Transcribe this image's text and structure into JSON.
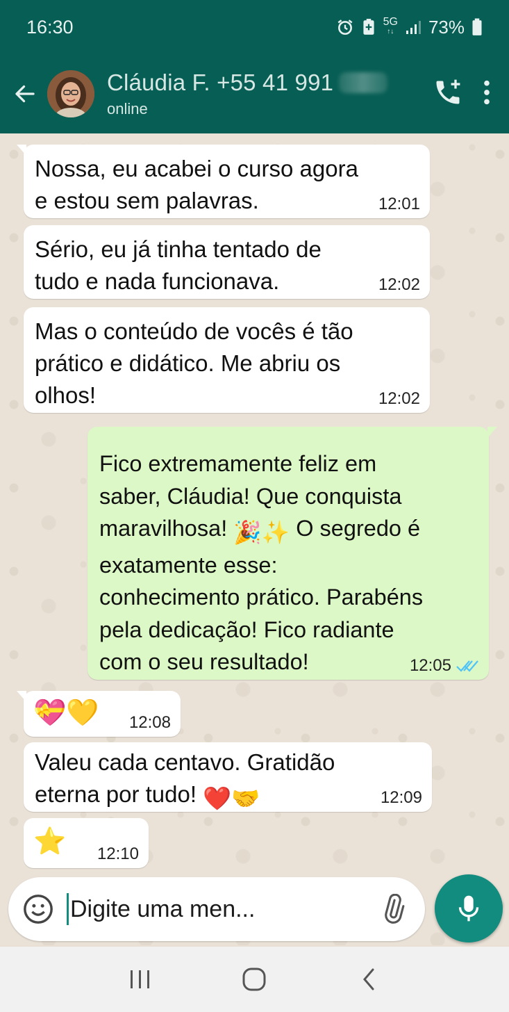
{
  "status_bar": {
    "time": "16:30",
    "network": "5G",
    "battery": "73%"
  },
  "header": {
    "contact_name": "Cláudia F. +55 41 991",
    "contact_status": "online"
  },
  "messages": [
    {
      "direction": "in",
      "text": "Nossa, eu acabei o curso agora\ne estou sem palavras.",
      "time": "12:01"
    },
    {
      "direction": "in",
      "text": "Sério, eu já tinha tentado de\ntudo e nada funcionava.",
      "time": "12:02"
    },
    {
      "direction": "in",
      "text": "Mas o conteúdo de vocês é tão\nprático e didático. Me abriu os\nolhos!",
      "time": "12:02"
    },
    {
      "direction": "out",
      "text_before": "Fico extremamente feliz em\nsaber, Cláudia! Que conquista\nmaravilhosa! ",
      "emoji": "🎉✨",
      "text_after": " O segredo é\nexatamente esse:\nconhecimento prático. Parabéns\npela  dedicação! Fico radiante\ncom o seu resultado!",
      "time": "12:05",
      "read": true
    },
    {
      "direction": "in",
      "emoji": "💝💛",
      "time": "12:08"
    },
    {
      "direction": "in",
      "text": "Valeu cada centavo. Gratidão\neterna por tudo! ",
      "emoji": "❤️🤝",
      "time": "12:09"
    },
    {
      "direction": "in",
      "emoji": "⭐",
      "time": "12:10"
    }
  ],
  "input": {
    "placeholder": "Digite uma men..."
  },
  "colors": {
    "header": "#075e54",
    "outgoing_bubble": "#dcf8c6",
    "incoming_bubble": "#ffffff",
    "accent": "#128c7e",
    "read_ticks": "#4fc3f7"
  },
  "icons": {
    "back": "arrow-left-icon",
    "add_call": "phone-plus-icon",
    "menu": "more-vertical-icon",
    "emoji": "smiley-icon",
    "attach": "paperclip-icon",
    "camera": "camera-icon",
    "mic": "microphone-icon"
  }
}
